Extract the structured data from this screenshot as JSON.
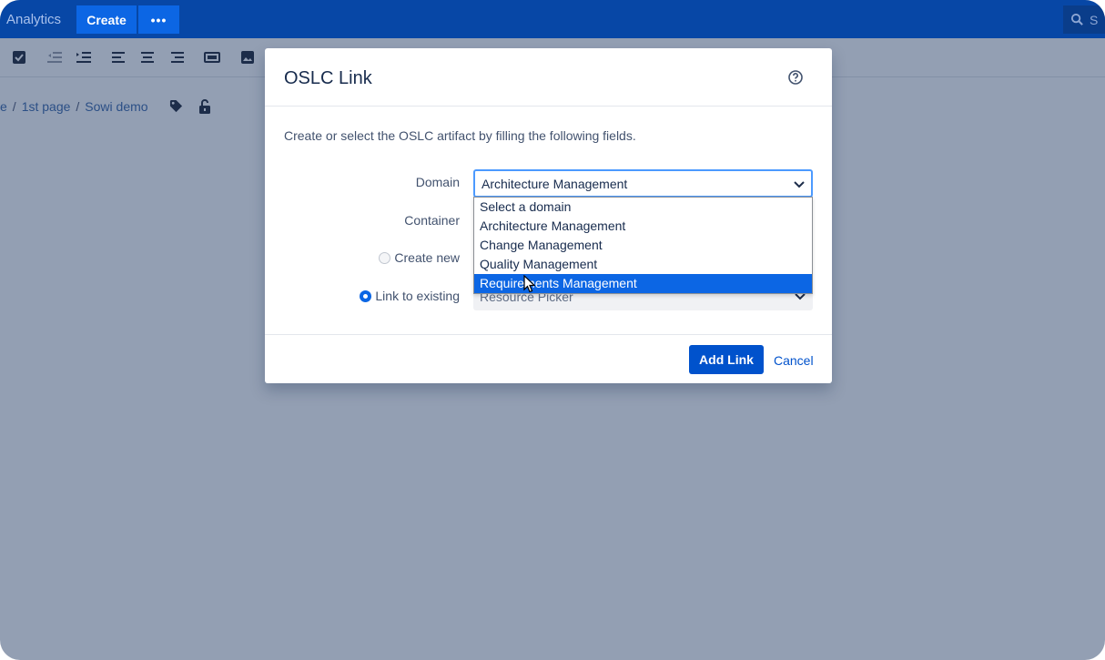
{
  "topnav": {
    "analytics_label": "Analytics",
    "create_label": "Create",
    "more_label": "•••",
    "search_partial": "S"
  },
  "breadcrumb": {
    "items": [
      "e",
      "1st page",
      "Sowi demo"
    ]
  },
  "dialog": {
    "title": "OSLC Link",
    "description": "Create or select the OSLC artifact by filling the following fields.",
    "domain_label": "Domain",
    "domain_value": "Architecture Management",
    "container_label": "Container",
    "create_new_label": "Create new",
    "link_existing_label": "Link to existing",
    "picker_value": "Resource Picker",
    "domain_options": [
      "Select a domain",
      "Architecture Management",
      "Change Management",
      "Quality Management",
      "Requirements Management"
    ],
    "highlighted_option": "Requirements Management",
    "add_link_label": "Add Link",
    "cancel_label": "Cancel"
  },
  "colors": {
    "nav_bg": "#0747a6",
    "primary": "#0052cc",
    "overlay": "#939fb3"
  }
}
